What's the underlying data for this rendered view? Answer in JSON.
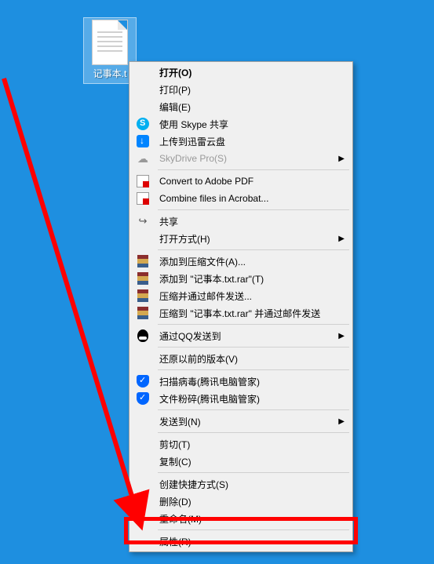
{
  "file": {
    "label": "记事本.t"
  },
  "menu": {
    "items": [
      {
        "label": "打开(O)",
        "icon": "",
        "bold": true
      },
      {
        "label": "打印(P)",
        "icon": ""
      },
      {
        "label": "编辑(E)",
        "icon": ""
      },
      {
        "label": "使用 Skype 共享",
        "icon": "skype"
      },
      {
        "label": "上传到迅雷云盘",
        "icon": "xunlei"
      },
      {
        "label": "SkyDrive Pro(S)",
        "icon": "cloud",
        "submenu": true,
        "disabled": true
      },
      {
        "type": "separator"
      },
      {
        "label": "Convert to Adobe PDF",
        "icon": "pdf"
      },
      {
        "label": "Combine files in Acrobat...",
        "icon": "pdf"
      },
      {
        "type": "separator"
      },
      {
        "label": "共享",
        "icon": "share"
      },
      {
        "label": "打开方式(H)",
        "icon": "",
        "submenu": true
      },
      {
        "type": "separator"
      },
      {
        "label": "添加到压缩文件(A)...",
        "icon": "rar"
      },
      {
        "label": "添加到 \"记事本.txt.rar\"(T)",
        "icon": "rar"
      },
      {
        "label": "压缩并通过邮件发送...",
        "icon": "rar"
      },
      {
        "label": "压缩到 \"记事本.txt.rar\" 并通过邮件发送",
        "icon": "rar"
      },
      {
        "type": "separator"
      },
      {
        "label": "通过QQ发送到",
        "icon": "qq",
        "submenu": true
      },
      {
        "type": "separator"
      },
      {
        "label": "还原以前的版本(V)",
        "icon": ""
      },
      {
        "type": "separator"
      },
      {
        "label": "扫描病毒(腾讯电脑管家)",
        "icon": "shield"
      },
      {
        "label": "文件粉碎(腾讯电脑管家)",
        "icon": "shield"
      },
      {
        "type": "separator"
      },
      {
        "label": "发送到(N)",
        "icon": "",
        "submenu": true
      },
      {
        "type": "separator"
      },
      {
        "label": "剪切(T)",
        "icon": ""
      },
      {
        "label": "复制(C)",
        "icon": ""
      },
      {
        "type": "separator"
      },
      {
        "label": "创建快捷方式(S)",
        "icon": ""
      },
      {
        "label": "删除(D)",
        "icon": ""
      },
      {
        "label": "重命名(M)",
        "icon": ""
      },
      {
        "type": "separator"
      },
      {
        "label": "属性(R)",
        "icon": ""
      }
    ]
  }
}
